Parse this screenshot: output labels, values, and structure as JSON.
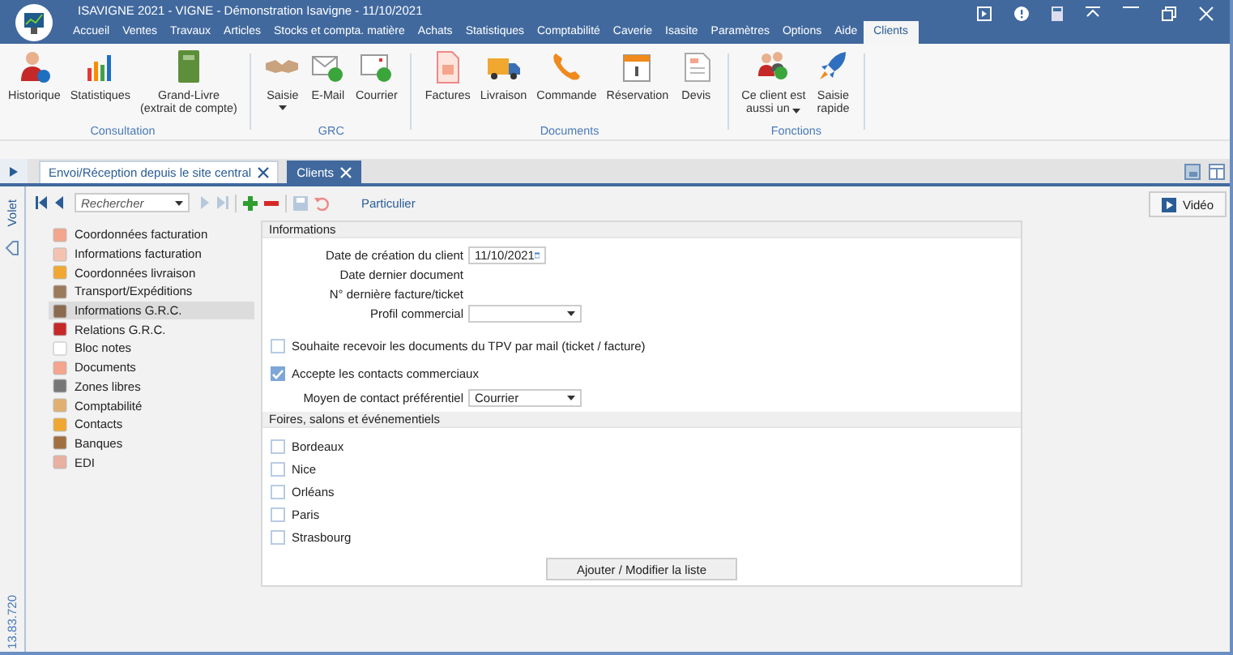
{
  "window": {
    "title": "ISAVIGNE 2021 - VIGNE - Démonstration Isavigne - 11/10/2021"
  },
  "menu": [
    {
      "label": "Accueil",
      "selected": false
    },
    {
      "label": "Ventes",
      "selected": false
    },
    {
      "label": "Travaux",
      "selected": false
    },
    {
      "label": "Articles",
      "selected": false
    },
    {
      "label": "Stocks et compta. matière",
      "selected": false
    },
    {
      "label": "Achats",
      "selected": false
    },
    {
      "label": "Statistiques",
      "selected": false
    },
    {
      "label": "Comptabilité",
      "selected": false
    },
    {
      "label": "Caverie",
      "selected": false
    },
    {
      "label": "Isasite",
      "selected": false
    },
    {
      "label": "Paramètres",
      "selected": false
    },
    {
      "label": "Options",
      "selected": false
    },
    {
      "label": "Aide",
      "selected": false
    },
    {
      "label": "Clients",
      "selected": true
    }
  ],
  "ribbon": [
    {
      "label": "Consultation",
      "buttons": [
        {
          "lines": [
            "Historique"
          ],
          "dropdown": false
        },
        {
          "lines": [
            "Statistiques"
          ],
          "dropdown": false
        },
        {
          "lines": [
            "Grand-Livre",
            "(extrait de compte)"
          ],
          "dropdown": false
        }
      ]
    },
    {
      "label": "GRC",
      "buttons": [
        {
          "lines": [
            "Saisie"
          ],
          "dropdown": true
        },
        {
          "lines": [
            "E-Mail"
          ],
          "dropdown": false
        },
        {
          "lines": [
            "Courrier"
          ],
          "dropdown": false
        }
      ]
    },
    {
      "label": "Documents",
      "buttons": [
        {
          "lines": [
            "Factures"
          ],
          "dropdown": false
        },
        {
          "lines": [
            "Livraison"
          ],
          "dropdown": false
        },
        {
          "lines": [
            "Commande"
          ],
          "dropdown": false
        },
        {
          "lines": [
            "Réservation"
          ],
          "dropdown": false
        },
        {
          "lines": [
            "Devis"
          ],
          "dropdown": false
        }
      ]
    },
    {
      "label": "Fonctions",
      "buttons": [
        {
          "lines": [
            "Ce client est",
            "aussi un"
          ],
          "dropdown": true
        },
        {
          "lines": [
            "Saisie",
            "rapide"
          ],
          "dropdown": false
        }
      ]
    }
  ],
  "side_panel": {
    "label": "Volet",
    "version": "13.83.720"
  },
  "doc_tabs": [
    {
      "label": "Envoi/Réception depuis le site central",
      "selected": false
    },
    {
      "label": "Clients",
      "selected": true
    }
  ],
  "toolbar": {
    "search_placeholder": "Rechercher",
    "client_type": "Particulier"
  },
  "video_button": "Vidéo",
  "nav": [
    {
      "label": "Coordonnées facturation",
      "selected": false
    },
    {
      "label": "Informations facturation",
      "selected": false
    },
    {
      "label": "Coordonnées livraison",
      "selected": false
    },
    {
      "label": "Transport/Expéditions",
      "selected": false
    },
    {
      "label": "Informations G.R.C.",
      "selected": true
    },
    {
      "label": "Relations G.R.C.",
      "selected": false
    },
    {
      "label": "Bloc notes",
      "selected": false
    },
    {
      "label": "Documents",
      "selected": false
    },
    {
      "label": "Zones libres",
      "selected": false
    },
    {
      "label": "Comptabilité",
      "selected": false
    },
    {
      "label": "Contacts",
      "selected": false
    },
    {
      "label": "Banques",
      "selected": false
    },
    {
      "label": "EDI",
      "selected": false
    }
  ],
  "informations": {
    "title": "Informations",
    "rows": [
      {
        "kind": "date",
        "label": "Date de création du client",
        "value": "11/10/2021"
      },
      {
        "kind": "readonly",
        "label": "Date dernier document"
      },
      {
        "kind": "readonly",
        "label": "N° dernière facture/ticket"
      },
      {
        "kind": "select",
        "label": "Profil commercial"
      },
      {
        "kind": "checkbox",
        "label": "Souhaite recevoir les documents du TPV par mail (ticket / facture)",
        "checked": false
      },
      {
        "kind": "checkbox",
        "label": "Accepte les contacts commerciaux",
        "checked": true
      },
      {
        "kind": "select",
        "label": "Moyen de contact préférentiel",
        "value": "Courrier"
      }
    ]
  },
  "events": {
    "title": "Foires, salons et événementiels",
    "items": [
      {
        "label": "Bordeaux",
        "checked": false
      },
      {
        "label": "Nice",
        "checked": false
      },
      {
        "label": "Orléans",
        "checked": false
      },
      {
        "label": "Paris",
        "checked": false
      },
      {
        "label": "Strasbourg",
        "checked": false
      }
    ],
    "button": "Ajouter / Modifier la liste"
  }
}
